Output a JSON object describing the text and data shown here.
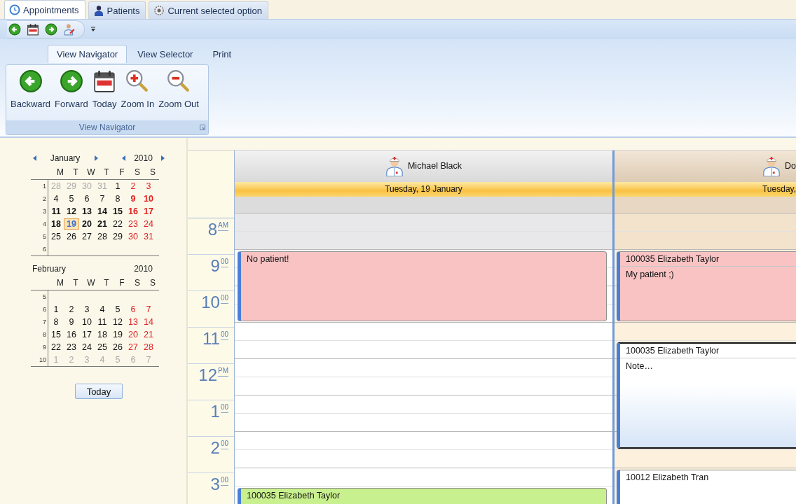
{
  "app_tabs": [
    {
      "label": "Appointments",
      "selected": true
    },
    {
      "label": "Patients",
      "selected": false
    },
    {
      "label": "Current selected option",
      "selected": false
    }
  ],
  "ribbon": {
    "tabs": [
      {
        "label": "View Navigator",
        "selected": true
      },
      {
        "label": "View Selector",
        "selected": false
      },
      {
        "label": "Print",
        "selected": false
      }
    ],
    "group": {
      "label": "View Navigator",
      "buttons": [
        "Backward",
        "Forward",
        "Today",
        "Zoom In",
        "Zoom Out"
      ]
    }
  },
  "calendars": [
    {
      "month": "January",
      "year": "2010",
      "nav": true,
      "day_names": [
        "M",
        "T",
        "W",
        "T",
        "F",
        "S",
        "S"
      ],
      "weeks": [
        {
          "week": "1",
          "days": [
            {
              "text": "28",
              "kind": "other",
              "bold": false,
              "selected": false
            },
            {
              "text": "29",
              "kind": "other",
              "bold": false,
              "selected": false
            },
            {
              "text": "30",
              "kind": "other",
              "bold": false,
              "selected": false
            },
            {
              "text": "31",
              "kind": "other",
              "bold": false,
              "selected": false
            },
            {
              "text": "1",
              "kind": "weekday",
              "bold": false,
              "selected": false
            },
            {
              "text": "2",
              "kind": "weekend",
              "bold": false,
              "selected": false
            },
            {
              "text": "3",
              "kind": "weekend",
              "bold": false,
              "selected": false
            }
          ]
        },
        {
          "week": "2",
          "days": [
            {
              "text": "4",
              "kind": "weekday",
              "bold": false,
              "selected": false
            },
            {
              "text": "5",
              "kind": "weekday",
              "bold": false,
              "selected": false
            },
            {
              "text": "6",
              "kind": "weekday",
              "bold": false,
              "selected": false
            },
            {
              "text": "7",
              "kind": "weekday",
              "bold": false,
              "selected": false
            },
            {
              "text": "8",
              "kind": "weekday",
              "bold": false,
              "selected": false
            },
            {
              "text": "9",
              "kind": "weekend",
              "bold": true,
              "selected": false
            },
            {
              "text": "10",
              "kind": "weekend",
              "bold": true,
              "selected": false
            }
          ]
        },
        {
          "week": "3",
          "days": [
            {
              "text": "11",
              "kind": "weekday",
              "bold": true,
              "selected": false
            },
            {
              "text": "12",
              "kind": "weekday",
              "bold": true,
              "selected": false
            },
            {
              "text": "13",
              "kind": "weekday",
              "bold": true,
              "selected": false
            },
            {
              "text": "14",
              "kind": "weekday",
              "bold": true,
              "selected": false
            },
            {
              "text": "15",
              "kind": "weekday",
              "bold": true,
              "selected": false
            },
            {
              "text": "16",
              "kind": "weekend",
              "bold": true,
              "selected": false
            },
            {
              "text": "17",
              "kind": "weekend",
              "bold": true,
              "selected": false
            }
          ]
        },
        {
          "week": "4",
          "days": [
            {
              "text": "18",
              "kind": "weekday",
              "bold": true,
              "selected": false
            },
            {
              "text": "19",
              "kind": "weekday",
              "bold": true,
              "selected": true
            },
            {
              "text": "20",
              "kind": "weekday",
              "bold": true,
              "selected": false
            },
            {
              "text": "21",
              "kind": "weekday",
              "bold": true,
              "selected": false
            },
            {
              "text": "22",
              "kind": "weekday",
              "bold": false,
              "selected": false
            },
            {
              "text": "23",
              "kind": "weekend",
              "bold": false,
              "selected": false
            },
            {
              "text": "24",
              "kind": "weekend",
              "bold": false,
              "selected": false
            }
          ]
        },
        {
          "week": "5",
          "days": [
            {
              "text": "25",
              "kind": "weekday",
              "bold": false,
              "selected": false
            },
            {
              "text": "26",
              "kind": "weekday",
              "bold": false,
              "selected": false
            },
            {
              "text": "27",
              "kind": "weekday",
              "bold": false,
              "selected": false
            },
            {
              "text": "28",
              "kind": "weekday",
              "bold": false,
              "selected": false
            },
            {
              "text": "29",
              "kind": "weekday",
              "bold": false,
              "selected": false
            },
            {
              "text": "30",
              "kind": "weekend",
              "bold": false,
              "selected": false
            },
            {
              "text": "31",
              "kind": "weekend",
              "bold": false,
              "selected": false
            }
          ]
        },
        {
          "week": "6"
        }
      ]
    },
    {
      "month": "February",
      "year": "2010",
      "nav": false,
      "day_names": [
        "M",
        "T",
        "W",
        "T",
        "F",
        "S",
        "S"
      ],
      "weeks": [
        {
          "week": "5"
        },
        {
          "week": "6",
          "days": [
            {
              "text": "1",
              "kind": "weekday",
              "bold": false,
              "selected": false
            },
            {
              "text": "2",
              "kind": "weekday",
              "bold": false,
              "selected": false
            },
            {
              "text": "3",
              "kind": "weekday",
              "bold": false,
              "selected": false
            },
            {
              "text": "4",
              "kind": "weekday",
              "bold": false,
              "selected": false
            },
            {
              "text": "5",
              "kind": "weekday",
              "bold": false,
              "selected": false
            },
            {
              "text": "6",
              "kind": "weekend",
              "bold": false,
              "selected": false
            },
            {
              "text": "7",
              "kind": "weekend",
              "bold": false,
              "selected": false
            }
          ]
        },
        {
          "week": "7",
          "days": [
            {
              "text": "8",
              "kind": "weekday",
              "bold": false,
              "selected": false
            },
            {
              "text": "9",
              "kind": "weekday",
              "bold": false,
              "selected": false
            },
            {
              "text": "10",
              "kind": "weekday",
              "bold": false,
              "selected": false
            },
            {
              "text": "11",
              "kind": "weekday",
              "bold": false,
              "selected": false
            },
            {
              "text": "12",
              "kind": "weekday",
              "bold": false,
              "selected": false
            },
            {
              "text": "13",
              "kind": "weekend",
              "bold": false,
              "selected": false
            },
            {
              "text": "14",
              "kind": "weekend",
              "bold": false,
              "selected": false
            }
          ]
        },
        {
          "week": "8",
          "days": [
            {
              "text": "15",
              "kind": "weekday",
              "bold": false,
              "selected": false
            },
            {
              "text": "16",
              "kind": "weekday",
              "bold": false,
              "selected": false
            },
            {
              "text": "17",
              "kind": "weekday",
              "bold": false,
              "selected": false
            },
            {
              "text": "18",
              "kind": "weekday",
              "bold": false,
              "selected": false
            },
            {
              "text": "19",
              "kind": "weekday",
              "bold": false,
              "selected": false
            },
            {
              "text": "20",
              "kind": "weekend",
              "bold": false,
              "selected": false
            },
            {
              "text": "21",
              "kind": "weekend",
              "bold": false,
              "selected": false
            }
          ]
        },
        {
          "week": "9",
          "days": [
            {
              "text": "22",
              "kind": "weekday",
              "bold": false,
              "selected": false
            },
            {
              "text": "23",
              "kind": "weekday",
              "bold": false,
              "selected": false
            },
            {
              "text": "24",
              "kind": "weekday",
              "bold": false,
              "selected": false
            },
            {
              "text": "25",
              "kind": "weekday",
              "bold": false,
              "selected": false
            },
            {
              "text": "26",
              "kind": "weekday",
              "bold": false,
              "selected": false
            },
            {
              "text": "27",
              "kind": "weekend",
              "bold": false,
              "selected": false
            },
            {
              "text": "28",
              "kind": "weekend",
              "bold": false,
              "selected": false
            }
          ]
        },
        {
          "week": "10",
          "days": [
            {
              "text": "1",
              "kind": "other",
              "bold": false,
              "selected": false
            },
            {
              "text": "2",
              "kind": "other",
              "bold": false,
              "selected": false
            },
            {
              "text": "3",
              "kind": "other",
              "bold": false,
              "selected": false
            },
            {
              "text": "4",
              "kind": "other",
              "bold": false,
              "selected": false
            },
            {
              "text": "5",
              "kind": "other",
              "bold": false,
              "selected": false
            },
            {
              "text": "6",
              "kind": "other",
              "bold": false,
              "selected": false
            },
            {
              "text": "7",
              "kind": "other",
              "bold": false,
              "selected": false
            }
          ]
        }
      ]
    }
  ],
  "today_button": "Today",
  "scheduler": {
    "times": [
      {
        "hour": "8",
        "suffix": "AM"
      },
      {
        "hour": "9",
        "suffix": "00"
      },
      {
        "hour": "10",
        "suffix": "00"
      },
      {
        "hour": "11",
        "suffix": "00"
      },
      {
        "hour": "12",
        "suffix": "PM"
      },
      {
        "hour": "1",
        "suffix": "00"
      },
      {
        "hour": "2",
        "suffix": "00"
      },
      {
        "hour": "3",
        "suffix": "00"
      }
    ],
    "resources": [
      {
        "name": "Michael Black",
        "date": "Tuesday, 19 January",
        "selected": true,
        "appointments": [
          {
            "title": "No patient!",
            "color": "#f9c3c3",
            "selected": false
          },
          {
            "title": "100035 Elizabeth Taylor",
            "color": "#c9f08e",
            "selected": false
          }
        ]
      },
      {
        "name": "Do",
        "date": "Tuesday,",
        "selected": false,
        "appointments": [
          {
            "title": "100035 Elizabeth Taylor",
            "note": "My patient ;)",
            "color": "#f9c3c3",
            "selected": false
          },
          {
            "title": "100035 Elizabeth Taylor",
            "note": "Note…",
            "color": "#ffffff",
            "selected": true
          },
          {
            "title": "10012 Elizabeth Tran",
            "color": "#ffffff",
            "selected": false
          }
        ]
      }
    ]
  }
}
